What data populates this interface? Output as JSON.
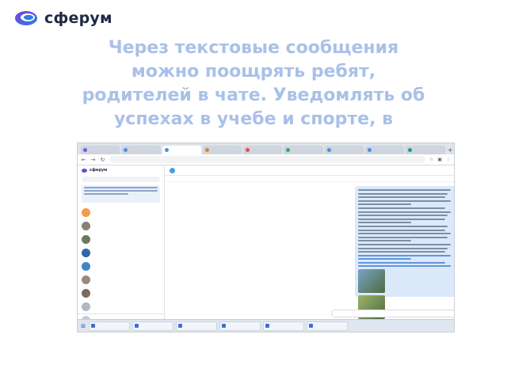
{
  "brand": {
    "name": "сферум",
    "logo_colors": [
      "#7a3fe0",
      "#2f7de6",
      "#1f2a44"
    ]
  },
  "slide": {
    "heading_lines": [
      "Через текстовые сообщения",
      "можно поощрять ребят,",
      "родителей в чате. Уведомлять об",
      "успехах в учебе и спорте, в"
    ],
    "heading_color": "#a9c1e8"
  },
  "browser": {
    "tabs": [
      {
        "label": "",
        "color": "#6c5ce7",
        "active": false
      },
      {
        "label": "",
        "color": "#4a90e2",
        "active": false
      },
      {
        "label": "",
        "color": "#4a90e2",
        "active": true
      },
      {
        "label": "",
        "color": "#e67e22",
        "active": false
      },
      {
        "label": "",
        "color": "#e74c3c",
        "active": false
      },
      {
        "label": "",
        "color": "#27ae60",
        "active": false
      },
      {
        "label": "",
        "color": "#4a90e2",
        "active": false
      },
      {
        "label": "",
        "color": "#4a90e2",
        "active": false
      },
      {
        "label": "",
        "color": "#16a085",
        "active": false
      }
    ],
    "url": "",
    "nav_icons": [
      "back-icon",
      "forward-icon",
      "reload-icon"
    ]
  },
  "app": {
    "sidebar": {
      "logo": "сферум",
      "search_placeholder": "",
      "chats": [
        {
          "name": "",
          "preview": "",
          "color": "#f39c4a"
        },
        {
          "name": "",
          "preview": "",
          "color": "#8a7f73"
        },
        {
          "name": "",
          "preview": "",
          "color": "#6b7a5e"
        },
        {
          "name": "",
          "preview": "",
          "color": "#2b6aa6"
        },
        {
          "name": "",
          "preview": "",
          "color": "#3d86c6"
        },
        {
          "name": "",
          "preview": "",
          "color": "#9a8a7a"
        },
        {
          "name": "",
          "preview": "",
          "color": "#7b6a5d"
        },
        {
          "name": "",
          "preview": "",
          "color": "#b0b8c4"
        },
        {
          "name": "",
          "preview": "",
          "color": "#c3c9d2"
        },
        {
          "name": "",
          "preview": "",
          "color": "#b5bcc7"
        }
      ],
      "bottom_label": ""
    },
    "chat": {
      "title": "",
      "subtitle": "",
      "pinned": "",
      "composer_placeholder": ""
    }
  },
  "taskbar": {
    "items": [
      {
        "label": ""
      },
      {
        "label": ""
      },
      {
        "label": ""
      },
      {
        "label": ""
      },
      {
        "label": ""
      },
      {
        "label": ""
      }
    ],
    "clock_time": "",
    "clock_date": ""
  }
}
